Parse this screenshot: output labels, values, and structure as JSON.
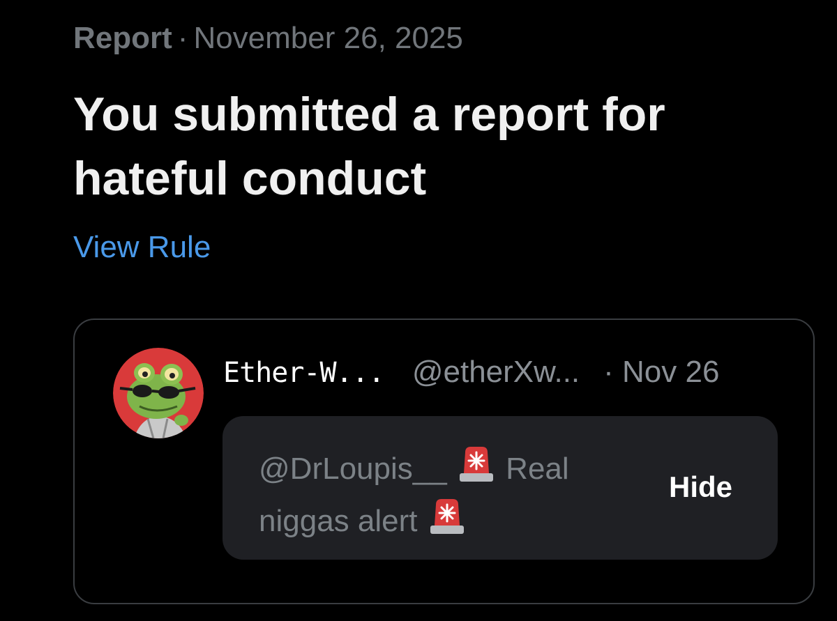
{
  "report": {
    "label": "Report",
    "separator": "·",
    "date": "November 26, 2025",
    "title": "You submitted a report for hateful conduct",
    "view_rule_label": "View Rule"
  },
  "post": {
    "avatar_icon": "frog-with-sunglasses-avatar",
    "display_name": "Ether-W...",
    "handle": "@etherXw...",
    "date": "· Nov 26",
    "text_part_1": "@DrLoupis__",
    "text_part_2": "Real niggas alert",
    "emoji_icon": "police-siren-icon",
    "hide_label": "Hide"
  },
  "colors": {
    "background": "#000000",
    "link": "#4a99e9",
    "muted": "#71767b",
    "card_border": "#3a3d41",
    "hidden_box": "#1f2024",
    "siren_red": "#d83a3a"
  }
}
